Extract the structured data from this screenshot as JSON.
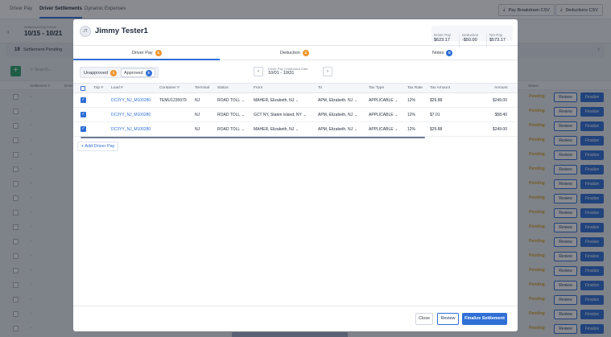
{
  "topbar": {
    "tabs": [
      "Driver Pay",
      "Driver Settlements",
      "Dynamic Expenses"
    ],
    "active_tab": "Driver Settlements",
    "pay_breakdown_csv": "Pay Breakdown CSV",
    "deductions_csv": "Deductions CSV"
  },
  "period": {
    "label": "Settlement Pay Period",
    "value": "10/15 - 10/21"
  },
  "pending": {
    "count": "19",
    "label": "Settlement Pending"
  },
  "background_table": {
    "search_placeholder": "Search...",
    "headers": {
      "settlement": "Settlement #",
      "driver": "Drive",
      "status": "Status"
    },
    "row_dash": "-",
    "status_pending": "Pending",
    "review_label": "Review",
    "finalize_label": "Finalize"
  },
  "modal": {
    "avatar_initials": "JT",
    "driver_name": "Jimmy Tester1",
    "summary": {
      "driver_pay_label": "Driver Pay",
      "driver_pay_value": "$623.17",
      "deduction_label": "Deduction",
      "deduction_value": "-$50.00",
      "net_pay_label": "Net Pay",
      "net_pay_value": "$573.17"
    },
    "tabs": [
      {
        "label": "Driver Pay",
        "badge": "4"
      },
      {
        "label": "Deduction",
        "badge": "2"
      },
      {
        "label": "Notes",
        "badge": "0"
      }
    ],
    "toggle": {
      "unapproved_label": "Unapproved",
      "unapproved_count": "1",
      "approved_label": "Approved",
      "approved_count": "3"
    },
    "date_nav": {
      "label": "Driver Pay | Deduction Date",
      "value": "10/01 - 10/31"
    },
    "columns": [
      "Trip #",
      "Load #",
      "Container #",
      "Terminal",
      "Status",
      "From",
      "To",
      "Tax Type",
      "Tax Rate",
      "Tax Amount",
      "Amount"
    ],
    "rows": [
      {
        "trip": "",
        "load": "DC3YY_NJ_M100280",
        "container": "TEMU1235979",
        "terminal": "NJ",
        "status": "ROAD TOLL",
        "from": "MAHER, Elizabeth, NJ",
        "to": "APM, Elizabeth, NJ",
        "tax_type": "APPLICABLE",
        "tax_rate": "12%",
        "tax_amount": "$29.88",
        "amount": "$249.00"
      },
      {
        "trip": "",
        "load": "DC3YY_NJ_M100280",
        "container": "",
        "terminal": "NJ",
        "status": "ROAD TOLL",
        "from": "GCT NY, Staten Island, NY",
        "to": "APM, Elizabeth, NJ",
        "tax_type": "APPLICABLE",
        "tax_rate": "12%",
        "tax_amount": "$7.01",
        "amount": "$58.40"
      },
      {
        "trip": "",
        "load": "DC3YY_NJ_M100280",
        "container": "",
        "terminal": "NJ",
        "status": "ROAD TOLL",
        "from": "MAHER, Elizabeth, NJ",
        "to": "APM, Elizabeth, NJ",
        "tax_type": "APPLICABLE",
        "tax_rate": "12%",
        "tax_amount": "$29.88",
        "amount": "$249.00"
      }
    ],
    "add_driver_pay": "+ Add Driver Pay",
    "footer": {
      "close": "Close",
      "review": "Review",
      "finalize": "Finalize Settlement"
    }
  },
  "colors": {
    "accent": "#2f6fd6",
    "badge_orange": "#f0962e",
    "pending": "#d9a12a",
    "add_green": "#27a36a"
  }
}
